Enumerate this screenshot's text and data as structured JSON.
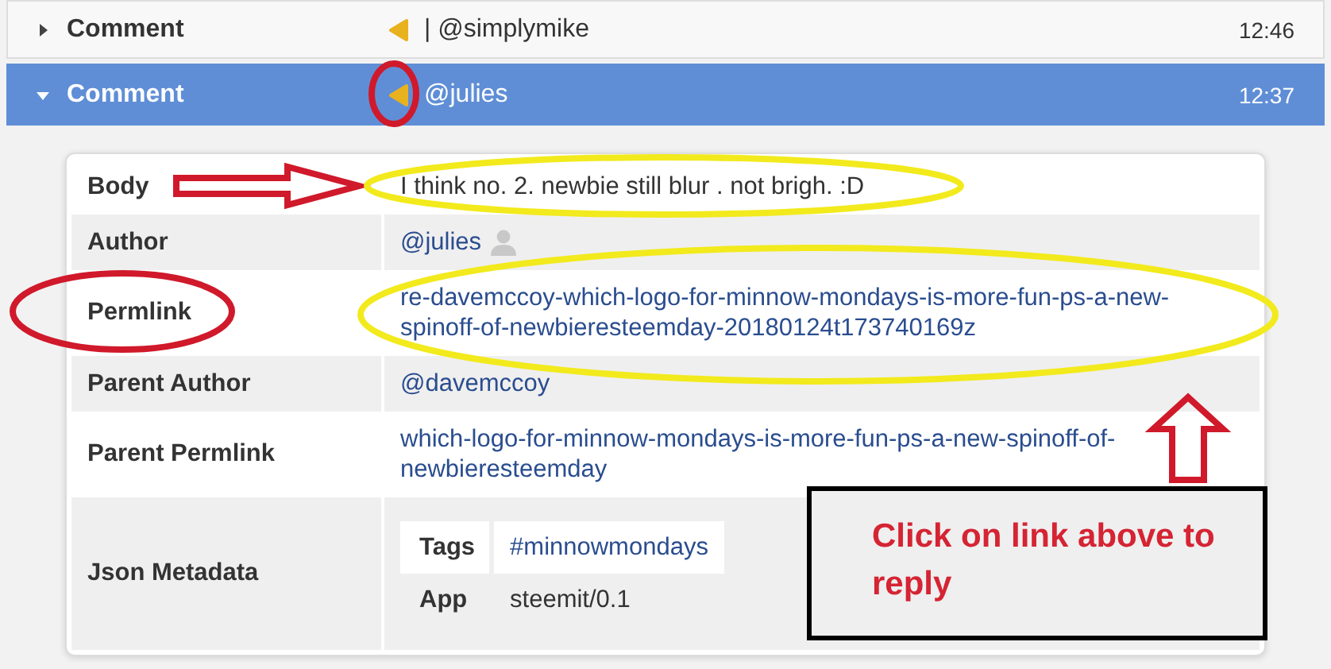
{
  "comments": [
    {
      "label": "Comment",
      "expanded": false,
      "author": "| @simplymike",
      "time": "12:46"
    },
    {
      "label": "Comment",
      "expanded": true,
      "author": "@julies",
      "time": "12:37"
    }
  ],
  "details": [
    {
      "kind": "text",
      "label": "Body",
      "value": "I think no. 2. newbie still blur . not brigh. :D"
    },
    {
      "kind": "author",
      "label": "Author",
      "value": "@julies"
    },
    {
      "kind": "link",
      "label": "Permlink",
      "value": "re-davemccoy-which-logo-for-minnow-mondays-is-more-fun-ps-a-new-spinoff-of-newbieresteemday-20180124t173740169z"
    },
    {
      "kind": "link",
      "label": "Parent Author",
      "value": "@davemccoy"
    },
    {
      "kind": "link",
      "label": "Parent Permlink",
      "value": "which-logo-for-minnow-mondays-is-more-fun-ps-a-new-spinoff-of-newbieresteemday"
    },
    {
      "kind": "meta",
      "label": "Json Metadata",
      "entries": [
        {
          "kind": "link",
          "key": "Tags",
          "value": "#minnowmondays"
        },
        {
          "kind": "text",
          "key": "App",
          "value": "steemit/0.1"
        }
      ]
    }
  ],
  "callout": {
    "text": "Click on link above to reply"
  }
}
